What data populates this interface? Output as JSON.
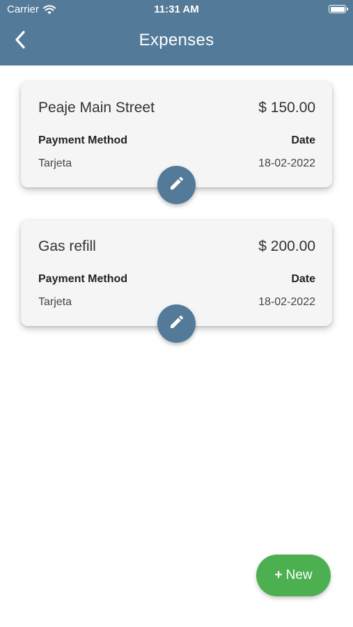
{
  "status_bar": {
    "carrier": "Carrier",
    "time": "11:31 AM"
  },
  "header": {
    "title": "Expenses",
    "back_icon": "chevron-left-icon"
  },
  "labels": {
    "payment_method": "Payment Method",
    "date": "Date"
  },
  "expenses": [
    {
      "title": "Peaje Main Street",
      "amount": "$ 150.00",
      "payment_method": "Tarjeta",
      "date": "18-02-2022"
    },
    {
      "title": "Gas refill",
      "amount": "$ 200.00",
      "payment_method": "Tarjeta",
      "date": "18-02-2022"
    }
  ],
  "new_button": {
    "plus": "+",
    "label": "New"
  },
  "colors": {
    "primary": "#537a98",
    "accent_green": "#4caf50",
    "card_background": "#f5f5f5"
  }
}
